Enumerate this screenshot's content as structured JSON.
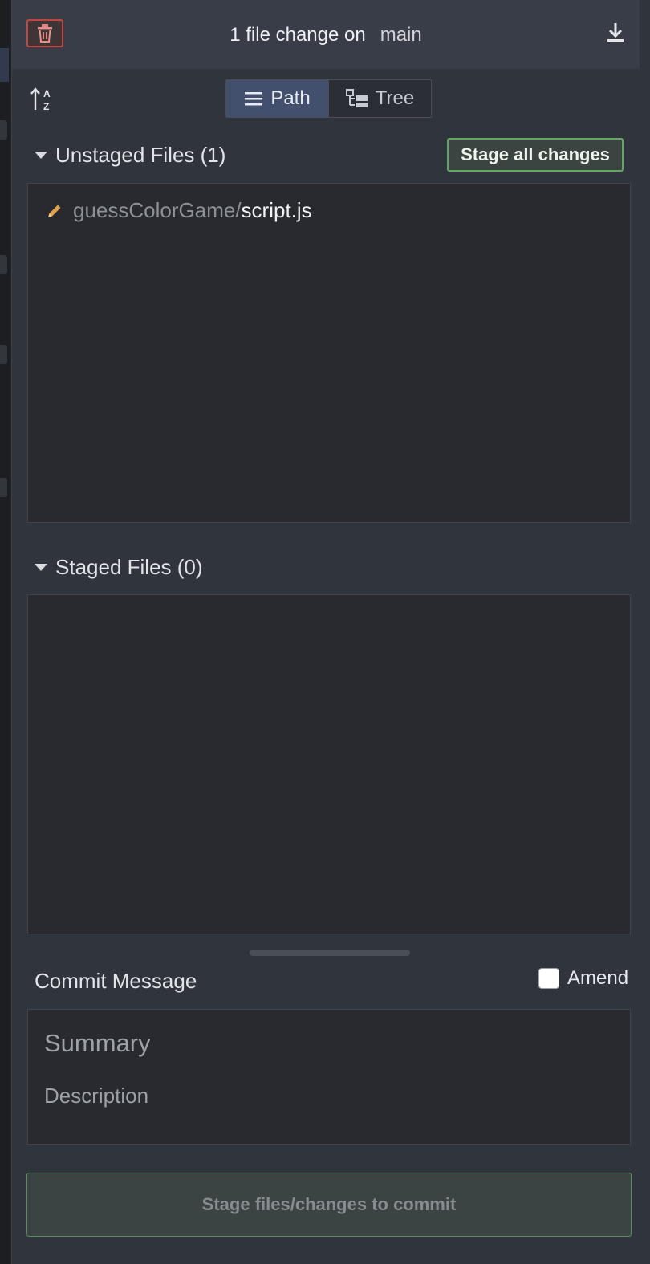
{
  "header": {
    "title": "1 file change on",
    "branch": "main",
    "discard_icon": "trash-icon",
    "download_icon": "download-icon"
  },
  "toolbar": {
    "sort_icon": "sort-alpha-icon",
    "view_modes": [
      {
        "label": "Path",
        "icon": "list-icon",
        "active": true
      },
      {
        "label": "Tree",
        "icon": "tree-icon",
        "active": false
      }
    ]
  },
  "unstaged": {
    "title": "Unstaged Files (1)",
    "stage_all_label": "Stage all changes",
    "files": [
      {
        "dir": "guessColorGame/",
        "name": "script.js",
        "status_icon": "pencil-icon"
      }
    ]
  },
  "staged": {
    "title": "Staged Files (0)",
    "files": []
  },
  "commit": {
    "label": "Commit Message",
    "amend_label": "Amend",
    "amend_checked": false,
    "summary_placeholder": "Summary",
    "description_placeholder": "Description",
    "button_label": "Stage files/changes to commit"
  },
  "colors": {
    "accent_blue": "#42506e",
    "stage_green": "#62a862",
    "discard_red": "#c2453f",
    "modified_orange": "#e0a24a"
  }
}
